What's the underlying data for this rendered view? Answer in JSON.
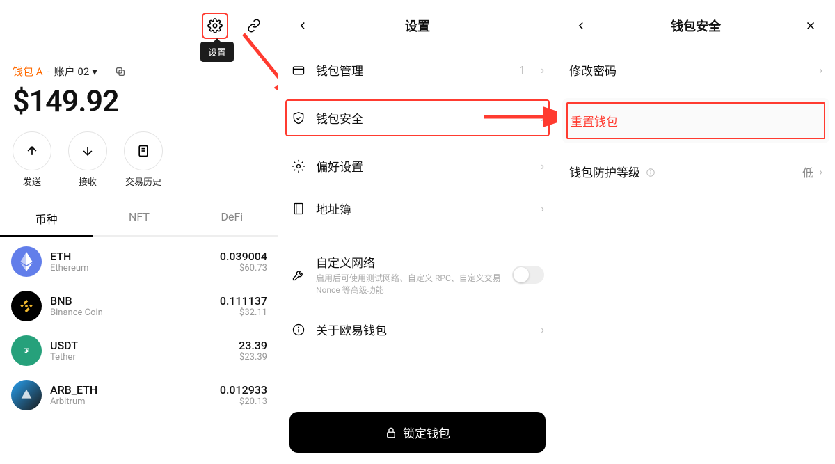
{
  "colors": {
    "highlight": "#ff3b30",
    "accent": "#ff6a00"
  },
  "pane1": {
    "tooltip": "设置",
    "wallet_name": "钱包 A",
    "account_label": "账户 02",
    "balance": "$149.92",
    "actions": {
      "send": "发送",
      "receive": "接收",
      "history": "交易历史"
    },
    "tabs": {
      "coins": "币种",
      "nft": "NFT",
      "defi": "DeFi"
    },
    "coins": [
      {
        "symbol": "ETH",
        "network": "Ethereum",
        "amount": "0.039004",
        "fiat": "$60.73"
      },
      {
        "symbol": "BNB",
        "network": "Binance Coin",
        "amount": "0.111137",
        "fiat": "$32.11"
      },
      {
        "symbol": "USDT",
        "network": "Tether",
        "amount": "23.39",
        "fiat": "$23.39"
      },
      {
        "symbol": "ARB_ETH",
        "network": "Arbitrum",
        "amount": "0.012933",
        "fiat": "$20.13"
      }
    ]
  },
  "pane2": {
    "title": "设置",
    "wallet_management": {
      "label": "钱包管理",
      "count": "1"
    },
    "wallet_security": {
      "label": "钱包安全"
    },
    "preferences": {
      "label": "偏好设置"
    },
    "address_book": {
      "label": "地址簿"
    },
    "custom_network": {
      "label": "自定义网络",
      "desc": "启用后可使用测试网络、自定义 RPC、自定义交易 Nonce 等高级功能"
    },
    "about": {
      "label": "关于欧易钱包"
    },
    "lock": "锁定钱包"
  },
  "pane3": {
    "title": "钱包安全",
    "change_pw": "修改密码",
    "reset_wallet": "重置钱包",
    "protection_level": {
      "label": "钱包防护等级",
      "value": "低"
    }
  }
}
